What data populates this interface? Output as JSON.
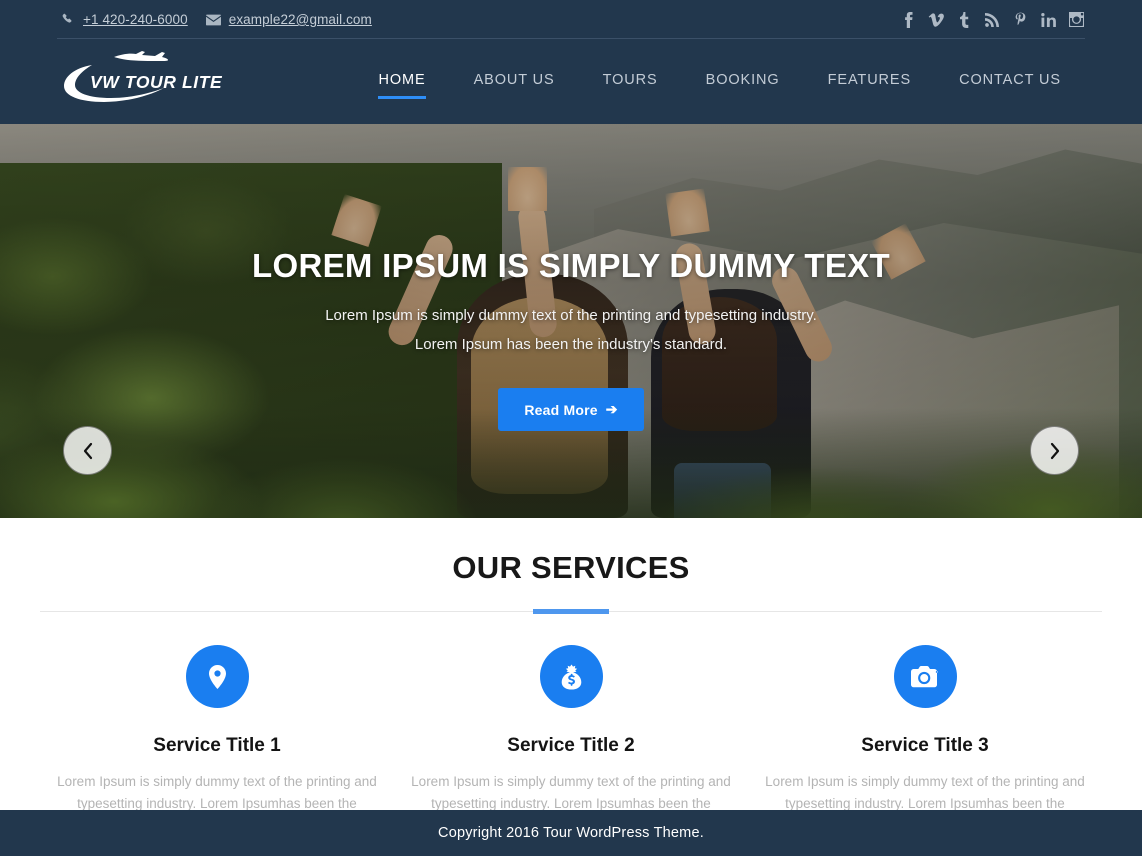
{
  "colors": {
    "header_bg": "#22374d",
    "accent_blue": "#1a7ef0",
    "nav_active_underline": "#2e8ef7",
    "divider_bar": "#4e97ee",
    "footer_bg": "#22374d",
    "muted_text": "#b4b4b4"
  },
  "topbar": {
    "phone": "+1 420-240-6000",
    "email": "example22@gmail.com",
    "phone_icon": "phone-icon",
    "email_icon": "envelope-icon",
    "social": [
      {
        "name": "facebook-icon",
        "glyph": "f"
      },
      {
        "name": "vimeo-icon",
        "glyph": "v"
      },
      {
        "name": "tumblr-icon",
        "glyph": "t"
      },
      {
        "name": "rss-icon",
        "glyph": "rss"
      },
      {
        "name": "pinterest-icon",
        "glyph": "P"
      },
      {
        "name": "linkedin-icon",
        "glyph": "in"
      },
      {
        "name": "instagram-icon",
        "glyph": "ig"
      }
    ]
  },
  "logo": {
    "text": "VW TOUR LITE",
    "icon": "airplane-swoosh-logo"
  },
  "nav": {
    "items": [
      {
        "label": "HOME",
        "active": true
      },
      {
        "label": "ABOUT US",
        "active": false
      },
      {
        "label": "TOURS",
        "active": false
      },
      {
        "label": "BOOKING",
        "active": false
      },
      {
        "label": "FEATURES",
        "active": false
      },
      {
        "label": "CONTACT US",
        "active": false
      }
    ]
  },
  "hero": {
    "title": "LOREM IPSUM IS SIMPLY DUMMY TEXT",
    "subtitle": "Lorem Ipsum is simply dummy text of the printing and typesetting industry. Lorem Ipsum has been the industry's standard.",
    "button_label": "Read More",
    "button_arrow": "➔",
    "prev_label": "previous-slide",
    "next_label": "next-slide"
  },
  "services": {
    "heading": "OUR SERVICES",
    "items": [
      {
        "icon": "map-pin-icon",
        "title": "Service Title 1",
        "text": "Lorem Ipsum is simply dummy text of the printing and typesetting industry. Lorem Ipsumhas been the industry."
      },
      {
        "icon": "money-bag-icon",
        "title": "Service Title 2",
        "text": "Lorem Ipsum is simply dummy text of the printing and typesetting industry. Lorem Ipsumhas been the industry."
      },
      {
        "icon": "camera-icon",
        "title": "Service Title 3",
        "text": "Lorem Ipsum is simply dummy text of the printing and typesetting industry. Lorem Ipsumhas been the industry."
      }
    ]
  },
  "footer": {
    "copyright": "Copyright 2016 Tour WordPress Theme."
  }
}
